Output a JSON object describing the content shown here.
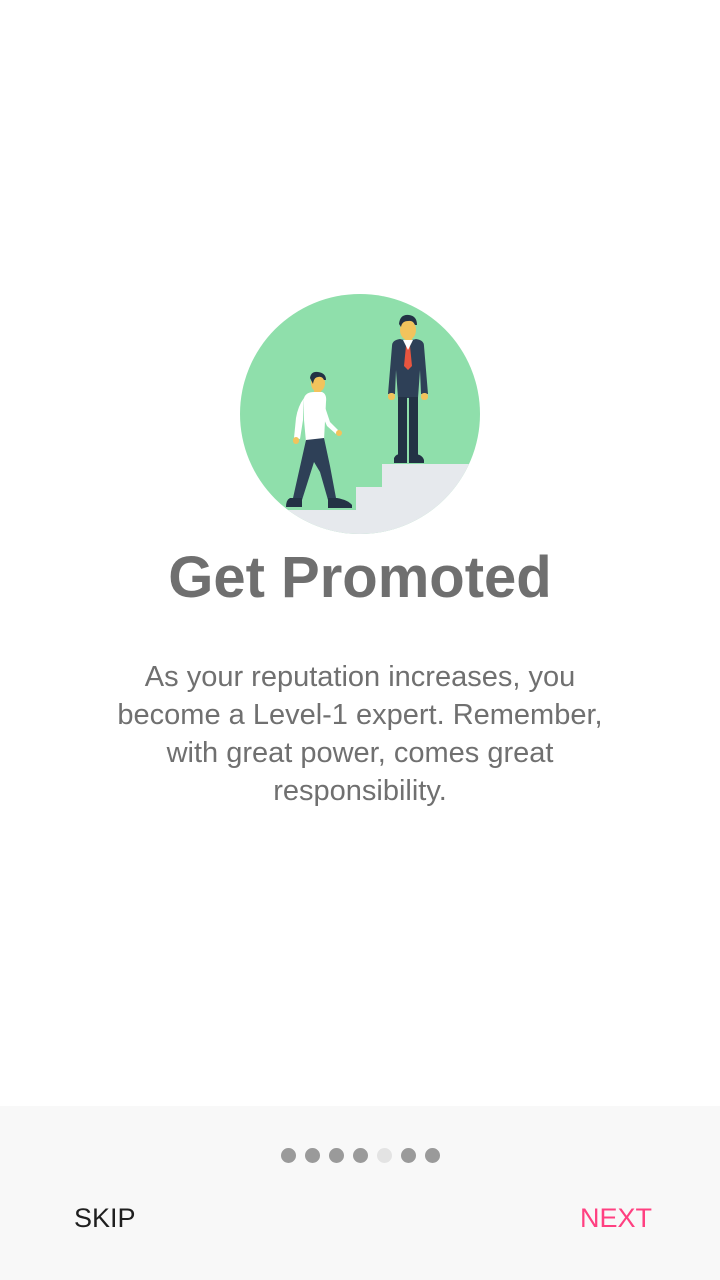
{
  "onboarding": {
    "title": "Get Promoted",
    "description": "As your reputation increases, you become a Level-1 expert. Remember, with great power, comes great responsibility.",
    "illustration_icon": "promotion-stairs-illustration"
  },
  "pager": {
    "total_pages": 7,
    "active_index": 4
  },
  "footer": {
    "skip_label": "SKIP",
    "next_label": "NEXT"
  },
  "colors": {
    "circle": "#8fdfab",
    "stairs": "#e6e9ed",
    "title": "#6f6f6f",
    "text": "#707070",
    "footer_bg": "#f8f8f8",
    "dot": "#9a9a9a",
    "dot_active": "#e3e3e3",
    "next_accent": "#ff4081",
    "skip": "#1f1f1f"
  }
}
